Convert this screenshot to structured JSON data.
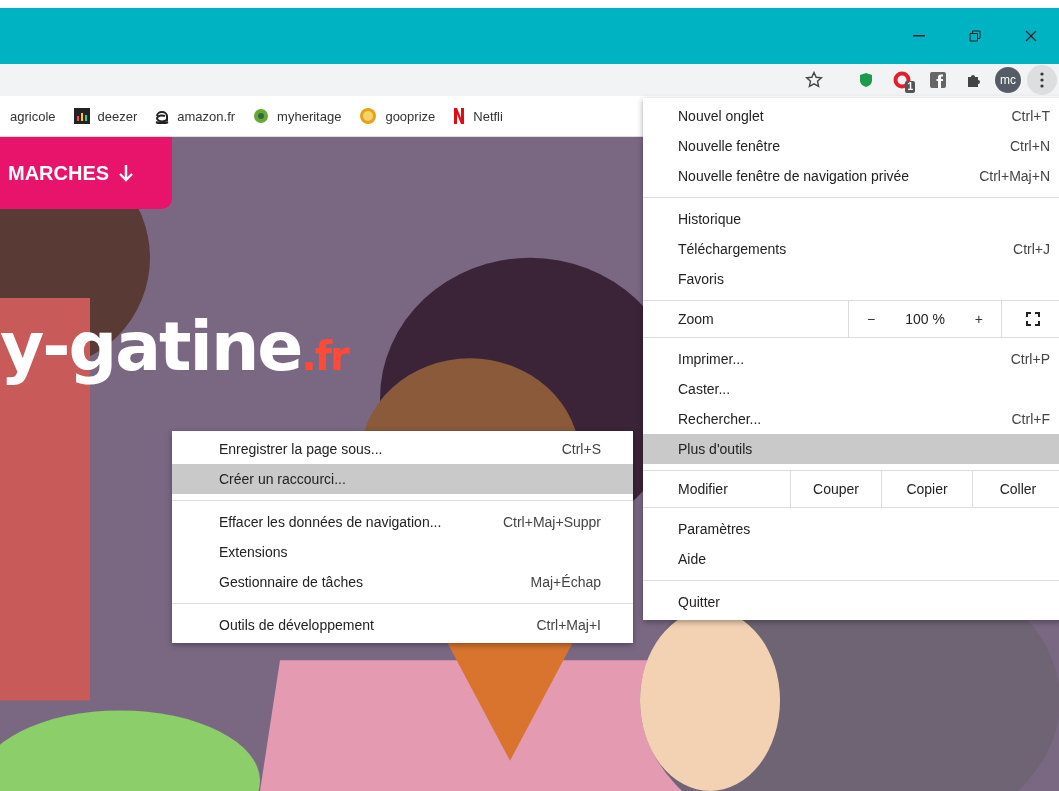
{
  "toolbar": {
    "extension_badge": "1",
    "avatar": "mc"
  },
  "bookmarks": [
    {
      "label": "agricole",
      "kind": "none"
    },
    {
      "label": "deezer",
      "kind": "deezer"
    },
    {
      "label": "amazon.fr",
      "kind": "amazon"
    },
    {
      "label": "myheritage",
      "kind": "heritage"
    },
    {
      "label": "gooprize",
      "kind": "gooprize"
    },
    {
      "label": "Netfli",
      "kind": "netflix"
    }
  ],
  "page": {
    "banner_button": "MARCHES",
    "logo": {
      "main": "y-gatine",
      "suffix": ".fr"
    }
  },
  "menu": {
    "sections": [
      [
        {
          "kind": "item",
          "label": "Nouvel onglet",
          "shortcut": "Ctrl+T",
          "selected": false
        },
        {
          "kind": "item",
          "label": "Nouvelle fenêtre",
          "shortcut": "Ctrl+N",
          "selected": false
        },
        {
          "kind": "item",
          "label": "Nouvelle fenêtre de navigation privée",
          "shortcut": "Ctrl+Maj+N",
          "selected": false
        }
      ],
      [
        {
          "kind": "item",
          "label": "Historique",
          "selected": false
        },
        {
          "kind": "item",
          "label": "Téléchargements",
          "shortcut": "Ctrl+J",
          "selected": false
        },
        {
          "kind": "item",
          "label": "Favoris",
          "selected": false
        }
      ],
      [
        {
          "kind": "zoom",
          "label": "Zoom",
          "minus": "−",
          "value": "100 %",
          "plus": "+"
        }
      ],
      [
        {
          "kind": "item",
          "label": "Imprimer...",
          "shortcut": "Ctrl+P",
          "selected": false
        },
        {
          "kind": "item",
          "label": "Caster...",
          "selected": false
        },
        {
          "kind": "item",
          "label": "Rechercher...",
          "shortcut": "Ctrl+F",
          "selected": false
        },
        {
          "kind": "item",
          "label": "Plus d'outils",
          "selected": true
        }
      ],
      [
        {
          "kind": "edit",
          "label": "Modifier",
          "buttons": [
            "Couper",
            "Copier",
            "Coller"
          ]
        }
      ],
      [
        {
          "kind": "item",
          "label": "Paramètres",
          "selected": false
        },
        {
          "kind": "item",
          "label": "Aide",
          "selected": false
        }
      ],
      [
        {
          "kind": "item",
          "label": "Quitter",
          "selected": false
        }
      ]
    ]
  },
  "submenu": {
    "sections": [
      [
        {
          "label": "Enregistrer la page sous...",
          "shortcut": "Ctrl+S",
          "selected": false
        },
        {
          "label": "Créer un raccourci...",
          "selected": true
        }
      ],
      [
        {
          "label": "Effacer les données de navigation...",
          "shortcut": "Ctrl+Maj+Suppr",
          "selected": false
        },
        {
          "label": "Extensions",
          "selected": false
        },
        {
          "label": "Gestionnaire de tâches",
          "shortcut": "Maj+Échap",
          "selected": false
        }
      ],
      [
        {
          "label": "Outils de développement",
          "shortcut": "Ctrl+Maj+I",
          "selected": false
        }
      ]
    ]
  }
}
